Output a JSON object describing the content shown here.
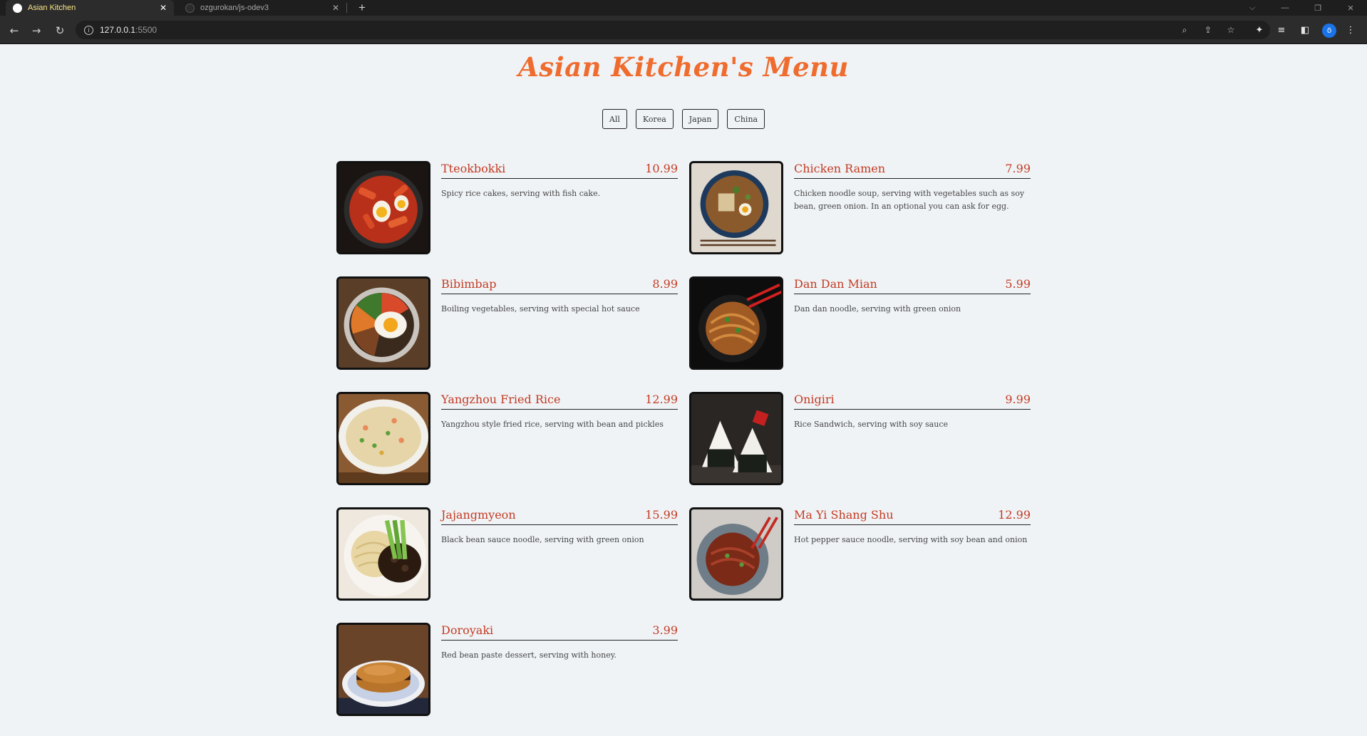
{
  "browser": {
    "tabs": [
      {
        "title": "Asian Kitchen",
        "active": true
      },
      {
        "title": "ozgurokan/js-odev3",
        "active": false
      }
    ],
    "new_tab_symbol": "+",
    "tab_close_symbol": "✕",
    "window_controls": {
      "tab_search": "⌵",
      "minimize": "—",
      "restore": "❐",
      "close": "✕"
    },
    "url": {
      "host": "127.0.0.1",
      "port": ":5500"
    },
    "profile_initial": "ö",
    "accent_color": "#1a73e8"
  },
  "page": {
    "title": "Asian Kitchen's Menu",
    "title_color": "#ef6c2e",
    "accent_color": "#c23b22",
    "filters": [
      "All",
      "Korea",
      "Japan",
      "China"
    ],
    "menu": [
      {
        "name": "Tteokbokki",
        "price": "10.99",
        "desc": "Spicy rice cakes, serving with fish cake.",
        "image": "tteokbokki-photo"
      },
      {
        "name": "Chicken Ramen",
        "price": "7.99",
        "desc": "Chicken noodle soup, serving with vegetables such as soy bean, green onion. In an optional you can ask for egg.",
        "image": "chicken-ramen-photo"
      },
      {
        "name": "Bibimbap",
        "price": "8.99",
        "desc": "Boiling vegetables, serving with special hot sauce",
        "image": "bibimbap-photo"
      },
      {
        "name": "Dan Dan Mian",
        "price": "5.99",
        "desc": "Dan dan noodle, serving with green onion",
        "image": "dan-dan-mian-photo"
      },
      {
        "name": "Yangzhou Fried Rice",
        "price": "12.99",
        "desc": "Yangzhou style fried rice, serving with bean and pickles",
        "image": "fried-rice-photo"
      },
      {
        "name": "Onigiri",
        "price": "9.99",
        "desc": "Rice Sandwich, serving with soy sauce",
        "image": "onigiri-photo"
      },
      {
        "name": "Jajangmyeon",
        "price": "15.99",
        "desc": "Black bean sauce noodle, serving with green onion",
        "image": "jajangmyeon-photo"
      },
      {
        "name": "Ma Yi Shang Shu",
        "price": "12.99",
        "desc": "Hot pepper sauce noodle, serving with soy bean and onion",
        "image": "ma-yi-shang-shu-photo"
      },
      {
        "name": "Doroyaki",
        "price": "3.99",
        "desc": "Red bean paste dessert, serving with honey.",
        "image": "dorayaki-photo"
      }
    ]
  }
}
